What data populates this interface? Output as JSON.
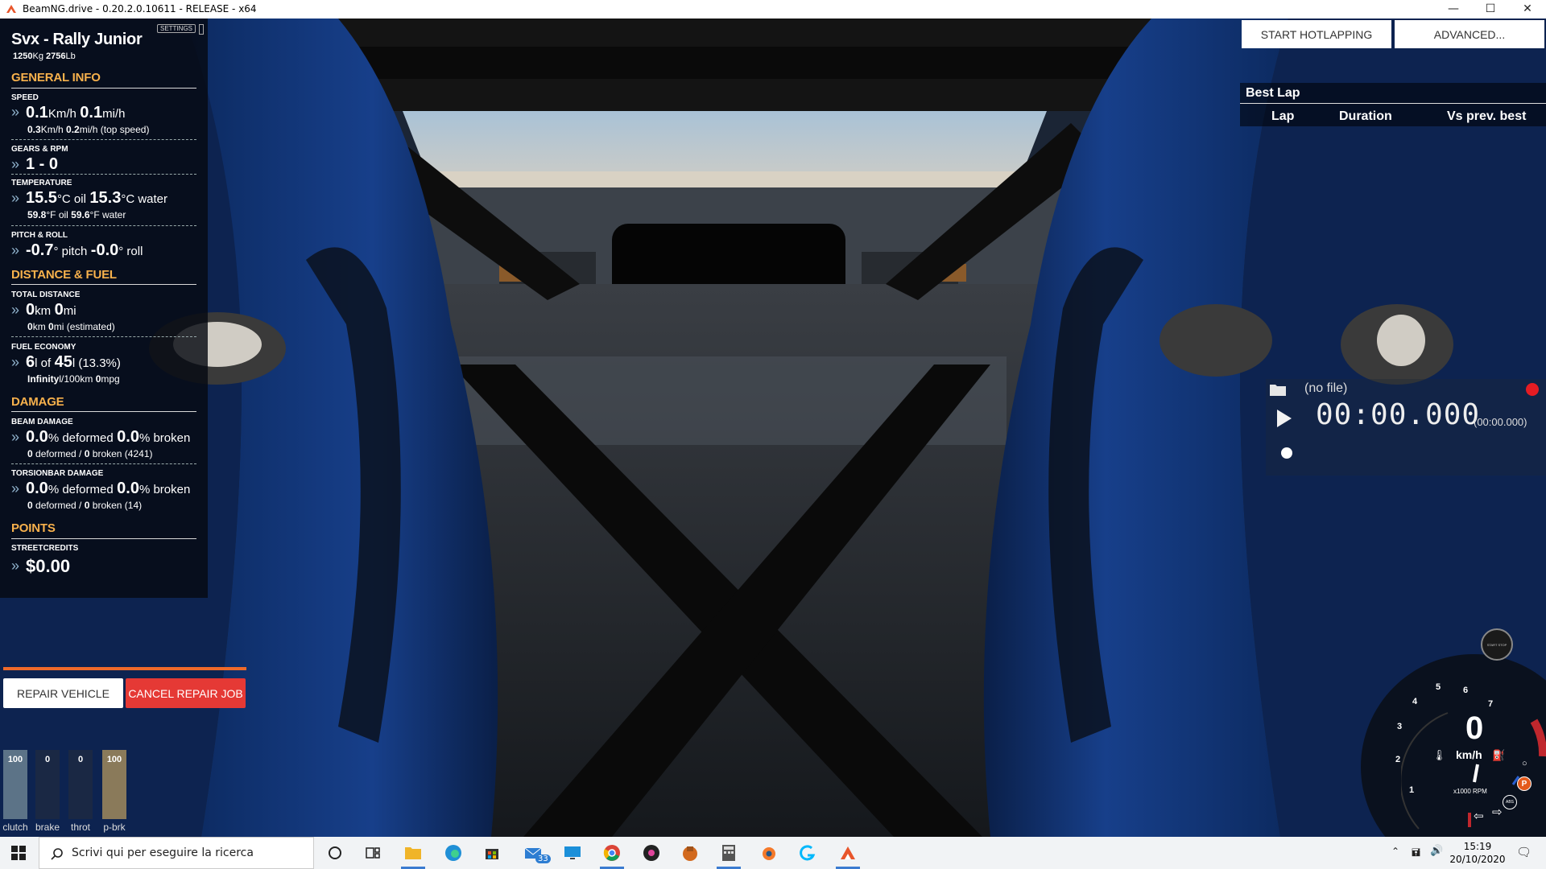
{
  "window": {
    "title": "BeamNG.drive - 0.20.2.0.10611 - RELEASE - x64"
  },
  "vehicle": {
    "name": "Svx - Rally Junior",
    "mass_kg": "1250",
    "mass_kg_unit": "Kg",
    "mass_lb": "2756",
    "mass_lb_unit": "Lb"
  },
  "panel": {
    "settings_label": "SETTINGS",
    "general_info": "GENERAL INFO",
    "speed": {
      "label": "SPEED",
      "kmh": "0.1",
      "kmh_unit": "Km/h",
      "mph": "0.1",
      "mph_unit": "mi/h",
      "top_kmh": "0.3",
      "top_kmh_unit": "Km/h",
      "top_mph": "0.2",
      "top_mph_unit": "mi/h (top speed)"
    },
    "gears": {
      "label": "GEARS & RPM",
      "value": "1 - 0"
    },
    "temperature": {
      "label": "TEMPERATURE",
      "oil_c": "15.5",
      "oil_c_unit": "°C oil",
      "water_c": "15.3",
      "water_c_unit": "°C water",
      "oil_f": "59.8",
      "oil_f_unit": "°F oil",
      "water_f": "59.6",
      "water_f_unit": "°F water"
    },
    "pitch_roll": {
      "label": "PITCH & ROLL",
      "pitch": "-0.7",
      "pitch_unit": "° pitch",
      "roll": "-0.0",
      "roll_unit": "° roll"
    },
    "distance_fuel": "DISTANCE & FUEL",
    "total_distance": {
      "label": "TOTAL DISTANCE",
      "km": "0",
      "km_unit": "km",
      "mi": "0",
      "mi_unit": "mi",
      "est_km": "0",
      "est_km_unit": "km",
      "est_mi": "0",
      "est_mi_unit": "mi (estimated)"
    },
    "fuel_economy": {
      "label": "FUEL ECONOMY",
      "fuel": "6",
      "fuel_unit": "l of",
      "capacity": "45",
      "capacity_unit": "l (13.3%)",
      "l100": "Infinity",
      "l100_unit": "l/100km",
      "mpg": "0",
      "mpg_unit": "mpg"
    },
    "damage": "DAMAGE",
    "beam_damage": {
      "label": "BEAM DAMAGE",
      "deformed_pct": "0.0",
      "deformed_unit": "% deformed",
      "broken_pct": "0.0",
      "broken_unit": "% broken",
      "deformed_count": "0",
      "deformed_count_unit": "deformed /",
      "broken_count": "0",
      "broken_count_unit": "broken (4241)"
    },
    "torsionbar_damage": {
      "label": "TORSIONBAR DAMAGE",
      "deformed_pct": "0.0",
      "deformed_unit": "% deformed",
      "broken_pct": "0.0",
      "broken_unit": "% broken",
      "deformed_count": "0",
      "deformed_count_unit": "deformed /",
      "broken_count": "0",
      "broken_count_unit": "broken (14)"
    },
    "points": "POINTS",
    "streetcredits": {
      "label": "STREETCREDITS",
      "value": "$0.00"
    },
    "chevron": "»"
  },
  "repair": {
    "repair_label": "REPAIR VEHICLE",
    "cancel_label": "CANCEL REPAIR JOB",
    "progress": 1.0
  },
  "pedals": [
    {
      "label": "clutch",
      "value": "100",
      "level": 1.0,
      "color": "#5c7387"
    },
    {
      "label": "brake",
      "value": "0",
      "level": 0.0,
      "color": "#8a3a3a"
    },
    {
      "label": "throt",
      "value": "0",
      "level": 0.0,
      "color": "#4a7a4a"
    },
    {
      "label": "p-brk",
      "value": "100",
      "level": 1.0,
      "color": "#8a7a5a"
    }
  ],
  "hotlap": {
    "start_label": "START HOTLAPPING",
    "advanced_label": "ADVANCED...",
    "best_lap": "Best Lap",
    "col_lap": "Lap",
    "col_duration": "Duration",
    "col_vs": "Vs prev. best"
  },
  "replay": {
    "file": "(no file)",
    "time": "00:00.000",
    "time_small": "(00:00.000)"
  },
  "gauge": {
    "speed": "0",
    "unit": "km/h",
    "rpm_label": "x1000 RPM",
    "ticks": [
      "1",
      "2",
      "3",
      "4",
      "5",
      "6",
      "7"
    ],
    "start_stop": "START STOP",
    "park_icon": "P",
    "abs_label": "ABS"
  },
  "taskbar": {
    "search_placeholder": "Scrivi qui per eseguire la ricerca",
    "mail_badge": "33",
    "time": "15:19",
    "date": "20/10/2020"
  },
  "colors": {
    "accent_orange": "#f8b14c",
    "cancel_red": "#e53935",
    "seat_blue": "#12357a"
  }
}
